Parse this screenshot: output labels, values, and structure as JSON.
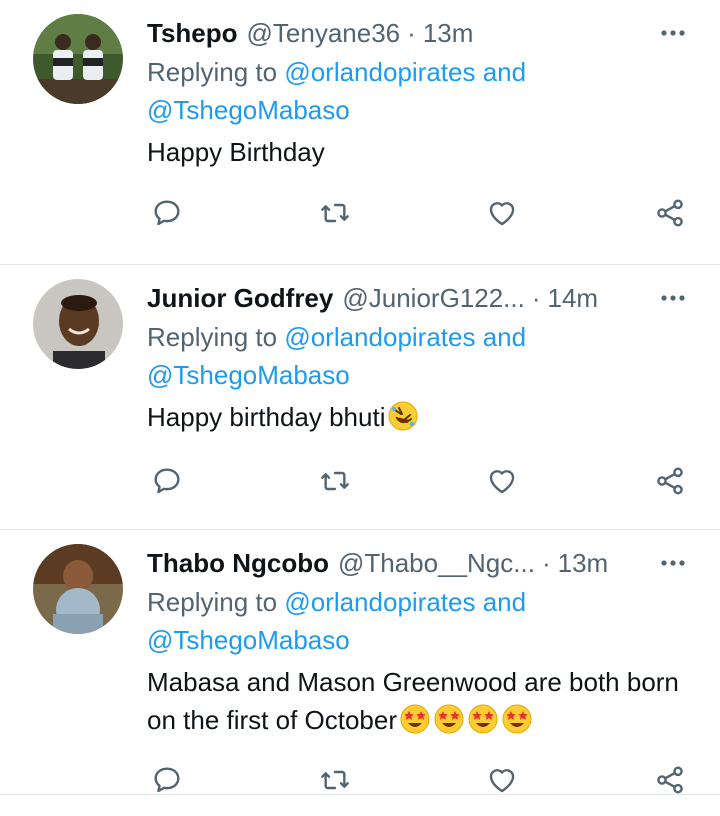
{
  "tweets": [
    {
      "name": "Tshepo",
      "handle": "@Tenyane36",
      "separator": "·",
      "time": "13m",
      "replying_prefix": "Replying to",
      "mention1": "@orlandopirates",
      "and_word": "and",
      "mention2": "@TshegoMabaso",
      "text": "Happy Birthday",
      "emojis": []
    },
    {
      "name": "Junior Godfrey",
      "handle": "@JuniorG122...",
      "separator": "·",
      "time": "14m",
      "replying_prefix": "Replying to",
      "mention1": "@orlandopirates",
      "and_word": "and",
      "mention2": "@TshegoMabaso",
      "text": "Happy birthday bhuti",
      "emojis": [
        "rolling-on-floor-laughing"
      ]
    },
    {
      "name": "Thabo Ngcobo",
      "handle": "@Thabo__Ngc...",
      "separator": "·",
      "time": "13m",
      "replying_prefix": "Replying to",
      "mention1": "@orlandopirates",
      "and_word": "and",
      "mention2": "@TshegoMabaso",
      "text": "Mabasa and Mason Greenwood are both born on the first of October",
      "emojis": [
        "star-struck",
        "star-struck",
        "star-struck",
        "star-struck"
      ]
    }
  ],
  "icons": {
    "reply": "reply-icon",
    "retweet": "retweet-icon",
    "like": "like-icon",
    "share": "share-icon",
    "more": "more-icon"
  },
  "colors": {
    "name": "#0f1419",
    "secondary": "#536471",
    "mention": "#1d9bf0",
    "divider": "#e3e7ea"
  }
}
